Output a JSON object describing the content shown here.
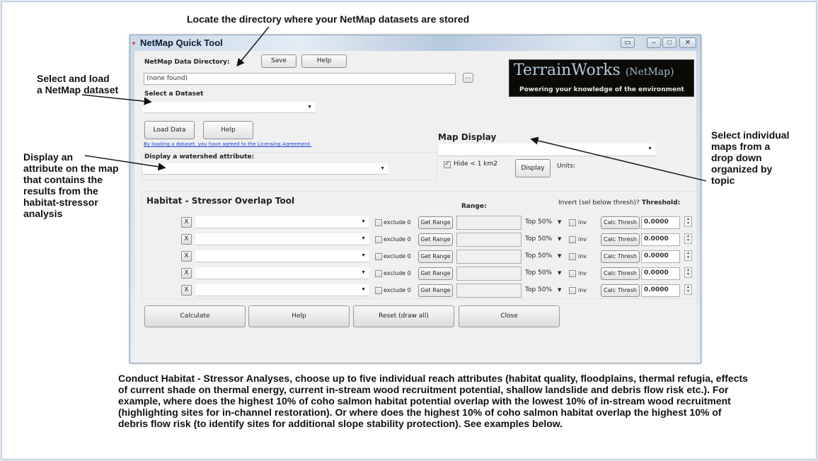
{
  "annotations": {
    "top": "Locate the directory where your NetMap datasets are stored",
    "left1": [
      "Select and load",
      "a NetMap dataset"
    ],
    "left2": [
      "Display an",
      "attribute on the map",
      "that contains the",
      "results from the",
      "habitat-stressor",
      "analysis"
    ],
    "right": [
      "Select individual",
      "maps from a",
      "drop down",
      "organized by",
      "topic"
    ],
    "bottom": "Conduct Habitat - Stressor Analyses, choose up to five individual reach attributes (habitat quality, floodplains, thermal refugia, effects of current shade on thermal energy, current in-stream wood recruitment potential, shallow landslide and debris flow risk etc.). For example, where does the highest 10% of coho salmon habitat potential overlap with the lowest 10% of in-stream wood recruitment (highlighting sites for in-channel restoration). Or where does the highest 10% of coho salmon habitat overlap the highest 10% of debris flow risk (to identify sites for additional slope stability protection). See examples below."
  },
  "window": {
    "title": "NetMap Quick Tool",
    "data_dir_label": "NetMap Data Directory:",
    "save_label": "Save",
    "help_label": "Help",
    "data_dir_value": "(none found)",
    "browse_label": "...",
    "select_dataset_label": "Select a Dataset",
    "load_data_label": "Load Data",
    "help2_label": "Help",
    "license_link": "By loading a dataset, you have agreed to the Licensing Agreement.",
    "watershed_label": "Display a watershed attribute:",
    "map_display_label": "Map Display",
    "hide_label": "Hide < 1 km2",
    "display_label": "Display",
    "units_label": "Units:",
    "logo_main": "TerrainWorks",
    "logo_paren": "(NetMap)",
    "logo_tagline": "Powering your knowledge of the environment"
  },
  "overlap": {
    "title": "Habitat - Stressor Overlap Tool",
    "range_header": "Range:",
    "invert_header": "Invert (sel below thresh)?",
    "threshold_header": "Threshold:",
    "rows": [
      {
        "x": "X",
        "exclude": "exclude 0",
        "get_range": "Get Range",
        "top": "Top 50%",
        "inv": "inv",
        "calc": "Calc Thresh",
        "threshold": "0.0000"
      },
      {
        "x": "X",
        "exclude": "exclude 0",
        "get_range": "Get Range",
        "top": "Top 50%",
        "inv": "inv",
        "calc": "Calc Thresh",
        "threshold": "0.0000"
      },
      {
        "x": "X",
        "exclude": "exclude 0",
        "get_range": "Get Range",
        "top": "Top 50%",
        "inv": "inv",
        "calc": "Calc Thresh",
        "threshold": "0.0000"
      },
      {
        "x": "X",
        "exclude": "exclude 0",
        "get_range": "Get Range",
        "top": "Top 50%",
        "inv": "inv",
        "calc": "Calc Thresh",
        "threshold": "0.0000"
      },
      {
        "x": "X",
        "exclude": "exclude 0",
        "get_range": "Get Range",
        "top": "Top 50%",
        "inv": "inv",
        "calc": "Calc Thresh",
        "threshold": "0.0000"
      }
    ]
  },
  "actions": {
    "calculate": "Calculate",
    "help": "Help",
    "reset": "Reset (draw all)",
    "close": "Close"
  }
}
